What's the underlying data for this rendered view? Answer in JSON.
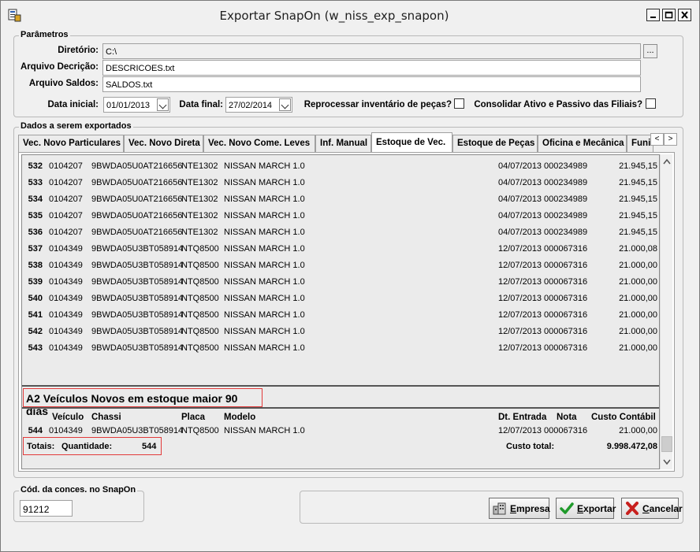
{
  "window": {
    "title": "Exportar SnapOn (w_niss_exp_snapon)"
  },
  "parametros": {
    "title": "Parâmetros",
    "diretorio_label": "Diretório:",
    "diretorio_value": "C:\\",
    "browse_label": "...",
    "arquivo_descricao_label": "Arquivo Decrição:",
    "arquivo_descricao_value": "DESCRICOES.txt",
    "arquivo_saldos_label": "Arquivo Saldos:",
    "arquivo_saldos_value": "SALDOS.txt",
    "data_inicial_label": "Data inicial:",
    "data_inicial_value": "01/01/2013",
    "data_final_label": "Data final:",
    "data_final_value": "27/02/2014",
    "reprocessar_label": "Reprocessar inventário de peças?",
    "consolidar_label": "Consolidar Ativo e Passivo das Filiais?"
  },
  "dados": {
    "title": "Dados a serem exportados",
    "tabs": [
      {
        "label": "Vec. Novo Particulares"
      },
      {
        "label": "Vec. Novo Direta"
      },
      {
        "label": "Vec. Novo Come. Leves"
      },
      {
        "label": "Inf. Manual"
      },
      {
        "label": "Estoque de Vec."
      },
      {
        "label": "Estoque de Peças"
      },
      {
        "label": "Oficina e Mecânica"
      },
      {
        "label": "Funi"
      }
    ],
    "tab_prev": "<",
    "tab_next": ">",
    "rows": [
      {
        "num": "532",
        "veiculo": "0104207",
        "chassi": "9BWDA05U0AT216656",
        "placa": "NTE1302",
        "modelo": "NISSAN MARCH 1.0",
        "dt_entrada": "04/07/2013",
        "nota": "000234989",
        "custo": "21.945,15"
      },
      {
        "num": "533",
        "veiculo": "0104207",
        "chassi": "9BWDA05U0AT216656",
        "placa": "NTE1302",
        "modelo": "NISSAN MARCH 1.0",
        "dt_entrada": "04/07/2013",
        "nota": "000234989",
        "custo": "21.945,15"
      },
      {
        "num": "534",
        "veiculo": "0104207",
        "chassi": "9BWDA05U0AT216656",
        "placa": "NTE1302",
        "modelo": "NISSAN MARCH 1.0",
        "dt_entrada": "04/07/2013",
        "nota": "000234989",
        "custo": "21.945,15"
      },
      {
        "num": "535",
        "veiculo": "0104207",
        "chassi": "9BWDA05U0AT216656",
        "placa": "NTE1302",
        "modelo": "NISSAN MARCH 1.0",
        "dt_entrada": "04/07/2013",
        "nota": "000234989",
        "custo": "21.945,15"
      },
      {
        "num": "536",
        "veiculo": "0104207",
        "chassi": "9BWDA05U0AT216656",
        "placa": "NTE1302",
        "modelo": "NISSAN MARCH 1.0",
        "dt_entrada": "04/07/2013",
        "nota": "000234989",
        "custo": "21.945,15"
      },
      {
        "num": "537",
        "veiculo": "0104349",
        "chassi": "9BWDA05U3BT058914",
        "placa": "NTQ8500",
        "modelo": "NISSAN MARCH 1.0",
        "dt_entrada": "12/07/2013",
        "nota": "000067316",
        "custo": "21.000,08"
      },
      {
        "num": "538",
        "veiculo": "0104349",
        "chassi": "9BWDA05U3BT058914",
        "placa": "NTQ8500",
        "modelo": "NISSAN MARCH 1.0",
        "dt_entrada": "12/07/2013",
        "nota": "000067316",
        "custo": "21.000,00"
      },
      {
        "num": "539",
        "veiculo": "0104349",
        "chassi": "9BWDA05U3BT058914",
        "placa": "NTQ8500",
        "modelo": "NISSAN MARCH 1.0",
        "dt_entrada": "12/07/2013",
        "nota": "000067316",
        "custo": "21.000,00"
      },
      {
        "num": "540",
        "veiculo": "0104349",
        "chassi": "9BWDA05U3BT058914",
        "placa": "NTQ8500",
        "modelo": "NISSAN MARCH 1.0",
        "dt_entrada": "12/07/2013",
        "nota": "000067316",
        "custo": "21.000,00"
      },
      {
        "num": "541",
        "veiculo": "0104349",
        "chassi": "9BWDA05U3BT058914",
        "placa": "NTQ8500",
        "modelo": "NISSAN MARCH 1.0",
        "dt_entrada": "12/07/2013",
        "nota": "000067316",
        "custo": "21.000,00"
      },
      {
        "num": "542",
        "veiculo": "0104349",
        "chassi": "9BWDA05U3BT058914",
        "placa": "NTQ8500",
        "modelo": "NISSAN MARCH 1.0",
        "dt_entrada": "12/07/2013",
        "nota": "000067316",
        "custo": "21.000,00"
      },
      {
        "num": "543",
        "veiculo": "0104349",
        "chassi": "9BWDA05U3BT058914",
        "placa": "NTQ8500",
        "modelo": "NISSAN MARCH 1.0",
        "dt_entrada": "12/07/2013",
        "nota": "000067316",
        "custo": "21.000,00"
      }
    ],
    "group": {
      "header": "A2 Veículos Novos em estoque maior 90 dias",
      "col_veiculo": "Veículo",
      "col_chassi": "Chassi",
      "col_placa": "Placa",
      "col_modelo": "Modelo",
      "col_dt_entrada": "Dt. Entrada",
      "col_nota": "Nota",
      "col_custo": "Custo Contábil",
      "row": {
        "num": "544",
        "veiculo": "0104349",
        "chassi": "9BWDA05U3BT058914",
        "placa": "NTQ8500",
        "modelo": "NISSAN MARCH 1.0",
        "dt_entrada": "12/07/2013",
        "nota": "000067316",
        "custo": "21.000,00"
      },
      "totais_label": "Totais:",
      "quantidade_label": "Quantidade:",
      "quantidade_value": "544",
      "custo_total_label": "Custo total:",
      "custo_total_value": "9.998.472,08"
    }
  },
  "codigo": {
    "title": "Cód. da conces. no SnapOn",
    "value": "91212"
  },
  "buttons": {
    "empresa": "Empresa",
    "exportar": "Exportar",
    "cancelar": "Cancelar"
  },
  "colors": {
    "highlight_border": "#e23a3a",
    "window_bg": "#f0f0f0"
  },
  "icons": [
    "app-icon",
    "minimize-icon",
    "maximize-icon",
    "close-icon",
    "building-icon",
    "checkmark-icon",
    "x-icon"
  ]
}
